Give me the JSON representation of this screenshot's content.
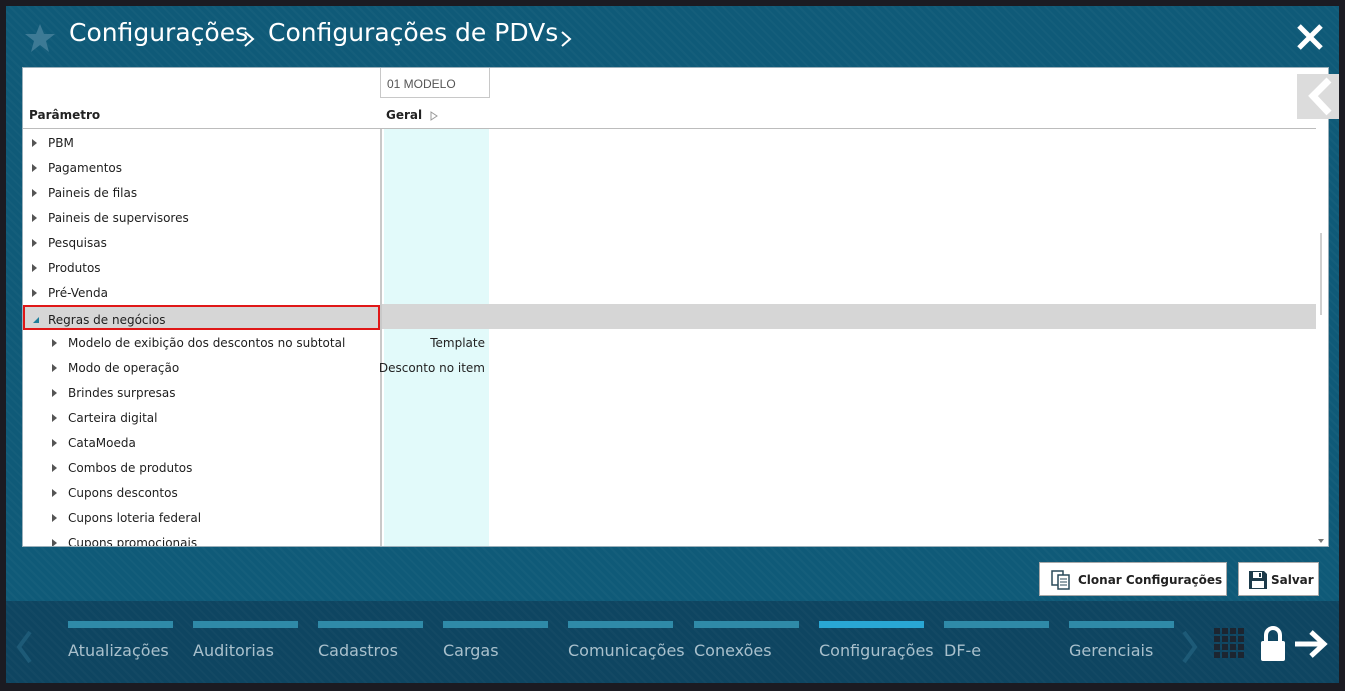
{
  "header": {
    "breadcrumb": [
      "Configurações",
      "Configurações de PDVs"
    ]
  },
  "grid": {
    "model_column": "01 MODELO",
    "param_header": "Parâmetro",
    "group_header": "Geral",
    "rows": [
      {
        "label": "PBM",
        "level": 0,
        "expanded": false,
        "value": ""
      },
      {
        "label": "Pagamentos",
        "level": 0,
        "expanded": false,
        "value": ""
      },
      {
        "label": "Paineis de filas",
        "level": 0,
        "expanded": false,
        "value": ""
      },
      {
        "label": "Paineis de supervisores",
        "level": 0,
        "expanded": false,
        "value": ""
      },
      {
        "label": "Pesquisas",
        "level": 0,
        "expanded": false,
        "value": ""
      },
      {
        "label": "Produtos",
        "level": 0,
        "expanded": false,
        "value": ""
      },
      {
        "label": "Pré-Venda",
        "level": 0,
        "expanded": false,
        "value": ""
      },
      {
        "label": "Regras de negócios",
        "level": 0,
        "expanded": true,
        "value": ""
      },
      {
        "label": "Modelo de exibição dos descontos no subtotal",
        "level": 1,
        "expanded": false,
        "value": "Template"
      },
      {
        "label": "Modo de operação",
        "level": 1,
        "expanded": false,
        "value": "Desconto no item"
      },
      {
        "label": "Brindes surpresas",
        "level": 1,
        "expanded": false,
        "value": ""
      },
      {
        "label": "Carteira digital",
        "level": 1,
        "expanded": false,
        "value": ""
      },
      {
        "label": "CataMoeda",
        "level": 1,
        "expanded": false,
        "value": ""
      },
      {
        "label": "Combos de produtos",
        "level": 1,
        "expanded": false,
        "value": ""
      },
      {
        "label": "Cupons descontos",
        "level": 1,
        "expanded": false,
        "value": ""
      },
      {
        "label": "Cupons loteria federal",
        "level": 1,
        "expanded": false,
        "value": ""
      },
      {
        "label": "Cupons promocionais",
        "level": 1,
        "expanded": false,
        "value": ""
      }
    ]
  },
  "actions": {
    "clone_label": "Clonar Configurações",
    "save_label": "Salvar"
  },
  "bottom_nav": {
    "items": [
      "Atualizações",
      "Auditorias",
      "Cadastros",
      "Cargas",
      "Comunicações",
      "Conexões",
      "Configurações",
      "DF-e",
      "Gerenciais"
    ],
    "active": "Configurações"
  },
  "colors": {
    "background": "#0f5a78",
    "bottom_bar": "#0e4561",
    "nav_bar": "#2f8aa8",
    "nav_bar_active": "#29a7d4",
    "model_column_bg": "#e2fafa",
    "highlight_border": "#e01818"
  }
}
